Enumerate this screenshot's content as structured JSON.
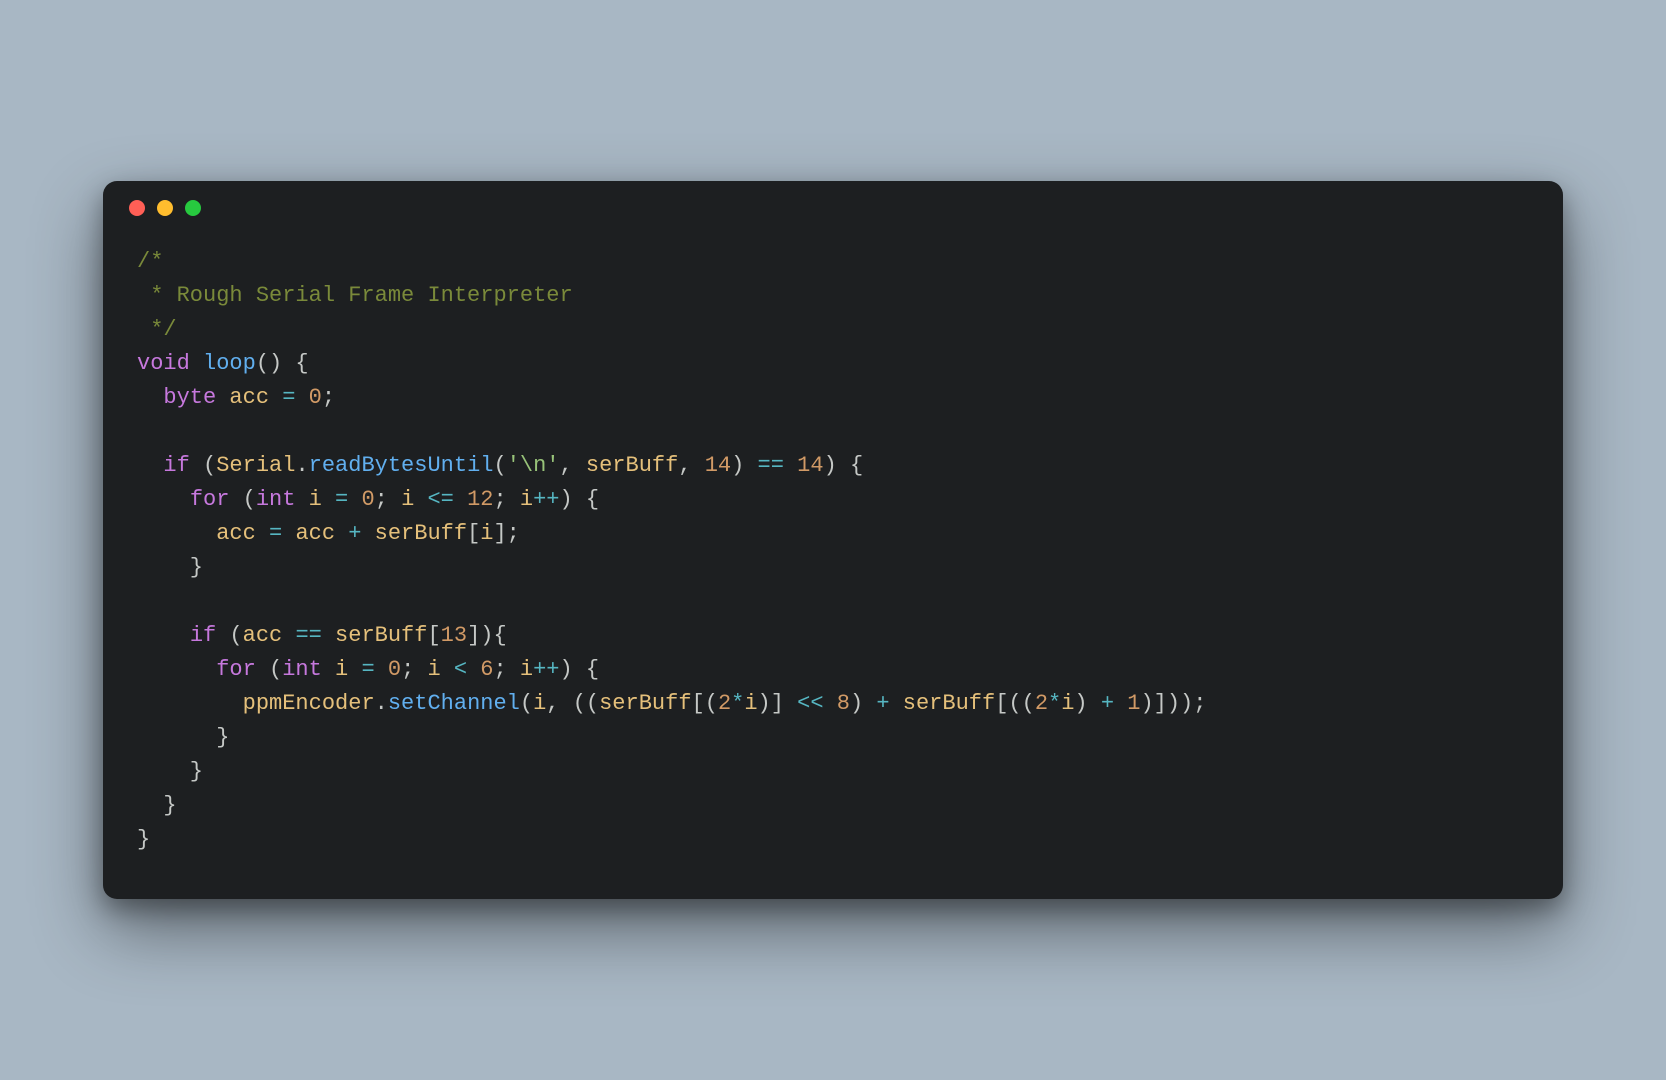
{
  "window": {
    "controls": [
      "close",
      "minimize",
      "zoom"
    ]
  },
  "code": {
    "lines": [
      [
        {
          "cls": "tok-comment",
          "text": "/*"
        }
      ],
      [
        {
          "cls": "tok-comment",
          "text": " * Rough Serial Frame Interpreter"
        }
      ],
      [
        {
          "cls": "tok-comment",
          "text": " */"
        }
      ],
      [
        {
          "cls": "tok-keyword",
          "text": "void"
        },
        {
          "cls": "tok-punc",
          "text": " "
        },
        {
          "cls": "tok-func",
          "text": "loop"
        },
        {
          "cls": "tok-punc",
          "text": "() {"
        }
      ],
      [
        {
          "cls": "tok-punc",
          "text": "  "
        },
        {
          "cls": "tok-type",
          "text": "byte"
        },
        {
          "cls": "tok-punc",
          "text": " "
        },
        {
          "cls": "tok-ident",
          "text": "acc"
        },
        {
          "cls": "tok-punc",
          "text": " "
        },
        {
          "cls": "tok-op",
          "text": "="
        },
        {
          "cls": "tok-punc",
          "text": " "
        },
        {
          "cls": "tok-num",
          "text": "0"
        },
        {
          "cls": "tok-punc",
          "text": ";"
        }
      ],
      [
        {
          "cls": "tok-punc",
          "text": ""
        }
      ],
      [
        {
          "cls": "tok-punc",
          "text": "  "
        },
        {
          "cls": "tok-keyword",
          "text": "if"
        },
        {
          "cls": "tok-punc",
          "text": " ("
        },
        {
          "cls": "tok-ident",
          "text": "Serial"
        },
        {
          "cls": "tok-punc",
          "text": "."
        },
        {
          "cls": "tok-func",
          "text": "readBytesUntil"
        },
        {
          "cls": "tok-punc",
          "text": "("
        },
        {
          "cls": "tok-str",
          "text": "'\\n'"
        },
        {
          "cls": "tok-punc",
          "text": ", "
        },
        {
          "cls": "tok-ident",
          "text": "serBuff"
        },
        {
          "cls": "tok-punc",
          "text": ", "
        },
        {
          "cls": "tok-num",
          "text": "14"
        },
        {
          "cls": "tok-punc",
          "text": ") "
        },
        {
          "cls": "tok-op",
          "text": "=="
        },
        {
          "cls": "tok-punc",
          "text": " "
        },
        {
          "cls": "tok-num",
          "text": "14"
        },
        {
          "cls": "tok-punc",
          "text": ") {"
        }
      ],
      [
        {
          "cls": "tok-punc",
          "text": "    "
        },
        {
          "cls": "tok-keyword",
          "text": "for"
        },
        {
          "cls": "tok-punc",
          "text": " ("
        },
        {
          "cls": "tok-type",
          "text": "int"
        },
        {
          "cls": "tok-punc",
          "text": " "
        },
        {
          "cls": "tok-ident",
          "text": "i"
        },
        {
          "cls": "tok-punc",
          "text": " "
        },
        {
          "cls": "tok-op",
          "text": "="
        },
        {
          "cls": "tok-punc",
          "text": " "
        },
        {
          "cls": "tok-num",
          "text": "0"
        },
        {
          "cls": "tok-punc",
          "text": "; "
        },
        {
          "cls": "tok-ident",
          "text": "i"
        },
        {
          "cls": "tok-punc",
          "text": " "
        },
        {
          "cls": "tok-op",
          "text": "<="
        },
        {
          "cls": "tok-punc",
          "text": " "
        },
        {
          "cls": "tok-num",
          "text": "12"
        },
        {
          "cls": "tok-punc",
          "text": "; "
        },
        {
          "cls": "tok-ident",
          "text": "i"
        },
        {
          "cls": "tok-op",
          "text": "++"
        },
        {
          "cls": "tok-punc",
          "text": ") {"
        }
      ],
      [
        {
          "cls": "tok-punc",
          "text": "      "
        },
        {
          "cls": "tok-ident",
          "text": "acc"
        },
        {
          "cls": "tok-punc",
          "text": " "
        },
        {
          "cls": "tok-op",
          "text": "="
        },
        {
          "cls": "tok-punc",
          "text": " "
        },
        {
          "cls": "tok-ident",
          "text": "acc"
        },
        {
          "cls": "tok-punc",
          "text": " "
        },
        {
          "cls": "tok-op",
          "text": "+"
        },
        {
          "cls": "tok-punc",
          "text": " "
        },
        {
          "cls": "tok-ident",
          "text": "serBuff"
        },
        {
          "cls": "tok-punc",
          "text": "["
        },
        {
          "cls": "tok-ident",
          "text": "i"
        },
        {
          "cls": "tok-punc",
          "text": "];"
        }
      ],
      [
        {
          "cls": "tok-punc",
          "text": "    }"
        }
      ],
      [
        {
          "cls": "tok-punc",
          "text": ""
        }
      ],
      [
        {
          "cls": "tok-punc",
          "text": "    "
        },
        {
          "cls": "tok-keyword",
          "text": "if"
        },
        {
          "cls": "tok-punc",
          "text": " ("
        },
        {
          "cls": "tok-ident",
          "text": "acc"
        },
        {
          "cls": "tok-punc",
          "text": " "
        },
        {
          "cls": "tok-op",
          "text": "=="
        },
        {
          "cls": "tok-punc",
          "text": " "
        },
        {
          "cls": "tok-ident",
          "text": "serBuff"
        },
        {
          "cls": "tok-punc",
          "text": "["
        },
        {
          "cls": "tok-num",
          "text": "13"
        },
        {
          "cls": "tok-punc",
          "text": "]){"
        }
      ],
      [
        {
          "cls": "tok-punc",
          "text": "      "
        },
        {
          "cls": "tok-keyword",
          "text": "for"
        },
        {
          "cls": "tok-punc",
          "text": " ("
        },
        {
          "cls": "tok-type",
          "text": "int"
        },
        {
          "cls": "tok-punc",
          "text": " "
        },
        {
          "cls": "tok-ident",
          "text": "i"
        },
        {
          "cls": "tok-punc",
          "text": " "
        },
        {
          "cls": "tok-op",
          "text": "="
        },
        {
          "cls": "tok-punc",
          "text": " "
        },
        {
          "cls": "tok-num",
          "text": "0"
        },
        {
          "cls": "tok-punc",
          "text": "; "
        },
        {
          "cls": "tok-ident",
          "text": "i"
        },
        {
          "cls": "tok-punc",
          "text": " "
        },
        {
          "cls": "tok-op",
          "text": "<"
        },
        {
          "cls": "tok-punc",
          "text": " "
        },
        {
          "cls": "tok-num",
          "text": "6"
        },
        {
          "cls": "tok-punc",
          "text": "; "
        },
        {
          "cls": "tok-ident",
          "text": "i"
        },
        {
          "cls": "tok-op",
          "text": "++"
        },
        {
          "cls": "tok-punc",
          "text": ") {"
        }
      ],
      [
        {
          "cls": "tok-punc",
          "text": "        "
        },
        {
          "cls": "tok-ident",
          "text": "ppmEncoder"
        },
        {
          "cls": "tok-punc",
          "text": "."
        },
        {
          "cls": "tok-func",
          "text": "setChannel"
        },
        {
          "cls": "tok-punc",
          "text": "("
        },
        {
          "cls": "tok-ident",
          "text": "i"
        },
        {
          "cls": "tok-punc",
          "text": ", (("
        },
        {
          "cls": "tok-ident",
          "text": "serBuff"
        },
        {
          "cls": "tok-punc",
          "text": "[("
        },
        {
          "cls": "tok-num",
          "text": "2"
        },
        {
          "cls": "tok-op",
          "text": "*"
        },
        {
          "cls": "tok-ident",
          "text": "i"
        },
        {
          "cls": "tok-punc",
          "text": ")] "
        },
        {
          "cls": "tok-op",
          "text": "<<"
        },
        {
          "cls": "tok-punc",
          "text": " "
        },
        {
          "cls": "tok-num",
          "text": "8"
        },
        {
          "cls": "tok-punc",
          "text": ") "
        },
        {
          "cls": "tok-op",
          "text": "+"
        },
        {
          "cls": "tok-punc",
          "text": " "
        },
        {
          "cls": "tok-ident",
          "text": "serBuff"
        },
        {
          "cls": "tok-punc",
          "text": "[(("
        },
        {
          "cls": "tok-num",
          "text": "2"
        },
        {
          "cls": "tok-op",
          "text": "*"
        },
        {
          "cls": "tok-ident",
          "text": "i"
        },
        {
          "cls": "tok-punc",
          "text": ") "
        },
        {
          "cls": "tok-op",
          "text": "+"
        },
        {
          "cls": "tok-punc",
          "text": " "
        },
        {
          "cls": "tok-num",
          "text": "1"
        },
        {
          "cls": "tok-punc",
          "text": ")]));"
        }
      ],
      [
        {
          "cls": "tok-punc",
          "text": "      }"
        }
      ],
      [
        {
          "cls": "tok-punc",
          "text": "    }"
        }
      ],
      [
        {
          "cls": "tok-punc",
          "text": "  }"
        }
      ],
      [
        {
          "cls": "tok-punc",
          "text": "}"
        }
      ]
    ]
  }
}
